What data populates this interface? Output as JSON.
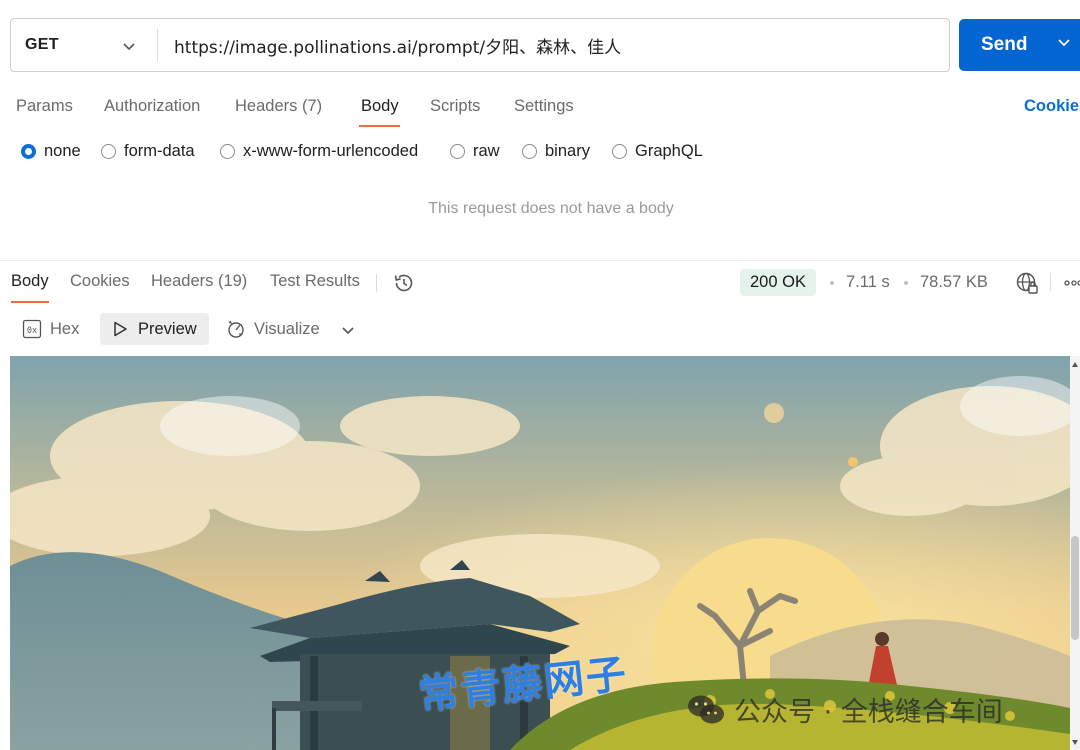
{
  "request": {
    "method": "GET",
    "url": "https://image.pollinations.ai/prompt/夕阳、森林、佳人",
    "send_label": "Send"
  },
  "request_tabs": [
    {
      "label": "Params"
    },
    {
      "label": "Authorization"
    },
    {
      "label": "Headers (7)"
    },
    {
      "label": "Body"
    },
    {
      "label": "Scripts"
    },
    {
      "label": "Settings"
    }
  ],
  "request_active_tab": "Body",
  "cookies_link": "Cookies",
  "body_types": [
    {
      "label": "none",
      "checked": true
    },
    {
      "label": "form-data",
      "checked": false
    },
    {
      "label": "x-www-form-urlencoded",
      "checked": false
    },
    {
      "label": "raw",
      "checked": false
    },
    {
      "label": "binary",
      "checked": false
    },
    {
      "label": "GraphQL",
      "checked": false
    }
  ],
  "no_body_message": "This request does not have a body",
  "response": {
    "tabs": [
      {
        "label": "Body"
      },
      {
        "label": "Cookies"
      },
      {
        "label": "Headers (19)"
      },
      {
        "label": "Test Results"
      }
    ],
    "active_tab": "Body",
    "status": "200 OK",
    "time": "7.11 s",
    "size": "78.57 KB",
    "views": [
      {
        "label": "Hex",
        "icon": "hex-icon"
      },
      {
        "label": "Preview",
        "icon": "play-icon"
      },
      {
        "label": "Visualize",
        "icon": "visualize-icon"
      }
    ],
    "active_view": "Preview"
  },
  "colors": {
    "accent": "#0265d2",
    "tab_underline": "#f26b3a",
    "status_bg": "#e4f4ec",
    "link": "#0b6fd6"
  },
  "watermark": {
    "left_text": "常青藤网子",
    "right_text": "公众号 · 全栈缝合车间"
  }
}
